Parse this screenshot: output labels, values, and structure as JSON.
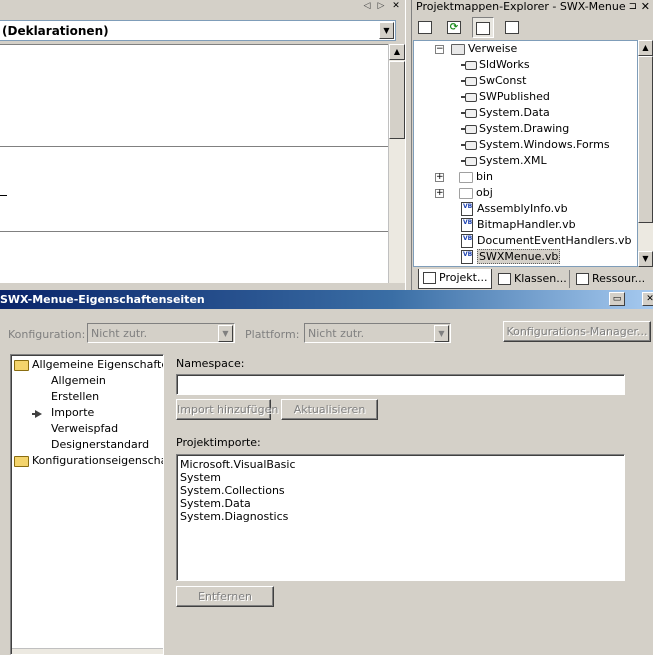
{
  "editor": {
    "declarations_combo": "(Deklarationen)",
    "nav_left": "◁",
    "nav_right": "▷",
    "close": "✕",
    "arrow_down": "▼",
    "arrow_up": "▲"
  },
  "solution_explorer": {
    "title": "Projektmappen-Explorer - SWX-Menue",
    "pin": "⊐",
    "close": "✕",
    "refresh_glyph": "⟳",
    "tree": {
      "references": "Verweise",
      "refs": [
        "SldWorks",
        "SwConst",
        "SWPublished",
        "System.Data",
        "System.Drawing",
        "System.Windows.Forms",
        "System.XML"
      ],
      "folders": [
        "bin",
        "obj"
      ],
      "files": [
        "AssemblyInfo.vb",
        "BitmapHandler.vb",
        "DocumentEventHandlers.vb",
        "SWXMenue.vb"
      ],
      "vb_badge": "VB",
      "expand_minus": "−",
      "expand_plus": "+"
    },
    "tabs": [
      "Projekt...",
      "Klassen...",
      "Ressour..."
    ]
  },
  "dialog": {
    "title": "SWX-Menue-Eigenschaftenseiten",
    "close": "✕",
    "configuration_label": "Konfiguration:",
    "configuration_value": "Nicht zutr.",
    "platform_label": "Plattform:",
    "platform_value": "Nicht zutr.",
    "config_manager_button": "Konfigurations-Manager...",
    "nav": {
      "common_properties": "Allgemeine Eigenschaften",
      "children": [
        "Allgemein",
        "Erstellen",
        "Importe",
        "Verweispfad",
        "Designerstandard"
      ],
      "selected_child": "Importe",
      "config_properties": "Konfigurationseigenschaften"
    },
    "namespace_label": "Namespace:",
    "namespace_value": "",
    "add_import_button": "Import hinzufügen",
    "update_button": "Aktualisieren",
    "project_imports_label": "Projektimporte:",
    "project_imports": [
      "Microsoft.VisualBasic",
      "System",
      "System.Collections",
      "System.Data",
      "System.Diagnostics"
    ],
    "remove_button": "Entfernen"
  }
}
